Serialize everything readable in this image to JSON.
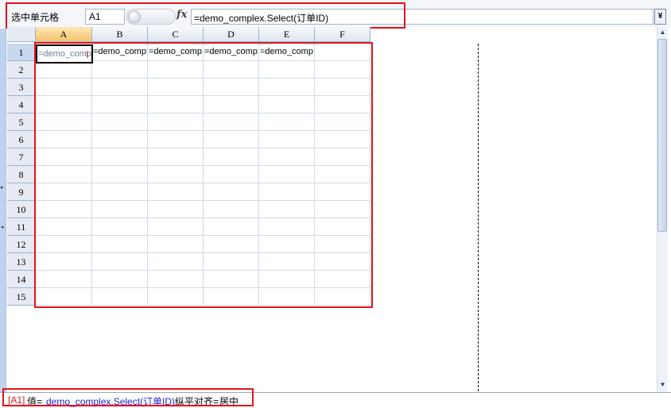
{
  "toolbar": {
    "label": "选中单元格",
    "cell_ref": "A1",
    "fx_icon": "fx-icon",
    "formula": "=demo_complex.Select(订单ID)",
    "dropdown_glyph": "¥"
  },
  "sheet": {
    "columns": [
      "A",
      "B",
      "C",
      "D",
      "E",
      "F"
    ],
    "rows": [
      "1",
      "2",
      "3",
      "4",
      "5",
      "6",
      "7",
      "8",
      "9",
      "10",
      "11",
      "12",
      "13",
      "14",
      "15"
    ],
    "row1_cells": [
      "=demo_comp",
      "=demo_comp",
      "=demo_comp",
      "=demo_comp",
      "=demo_comp",
      ""
    ],
    "selected_cell": "A1"
  },
  "status": {
    "ref": "[A1]",
    "value_key": "值=",
    "value": "demo_complex.Select(订单ID)",
    "align_key": "纵平对齐=",
    "align_value": "居中"
  },
  "colors": {
    "highlight": "#e0141e",
    "selected_header": "#f5c26b",
    "grid": "#d0dbe7"
  }
}
